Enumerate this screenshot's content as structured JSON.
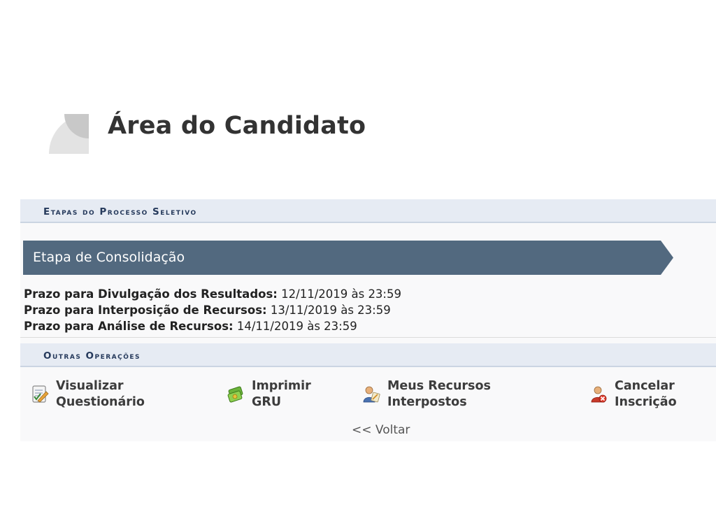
{
  "page": {
    "title": "Área do Candidato"
  },
  "stages_section": {
    "header": "Etapas do Processo Seletivo"
  },
  "stage": {
    "name": "Etapa de Consolidação",
    "bar_color": "#52697f",
    "deadlines": [
      {
        "label": "Prazo para Divulgação dos Resultados:",
        "value": "12/11/2019 às 23:59"
      },
      {
        "label": "Prazo para Interposição de Recursos:",
        "value": "13/11/2019 às 23:59"
      },
      {
        "label": "Prazo para Análise de Recursos:",
        "value": "14/11/2019 às 23:59"
      }
    ]
  },
  "operations_section": {
    "header": "Outras Operações",
    "items": [
      {
        "label": "Visualizar\nQuestionário",
        "icon": "questionnaire-icon"
      },
      {
        "label": "Imprimir\nGRU",
        "icon": "print-money-icon"
      },
      {
        "label": "Meus Recursos\nInterpostos",
        "icon": "user-document-icon"
      },
      {
        "label": "Cancelar\nInscrição",
        "icon": "user-cancel-icon"
      }
    ]
  },
  "back_link": "<< Voltar"
}
